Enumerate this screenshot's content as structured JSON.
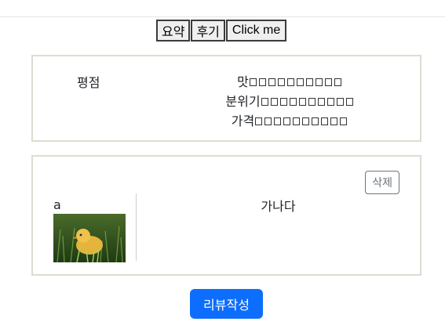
{
  "tabs": [
    {
      "label": "요약"
    },
    {
      "label": "후기"
    },
    {
      "label": "Click me"
    }
  ],
  "rating": {
    "label": "평점",
    "lines": [
      {
        "label": "맛",
        "boxes": 10
      },
      {
        "label": "분위기",
        "boxes": 10
      },
      {
        "label": "가격",
        "boxes": 10
      }
    ]
  },
  "review": {
    "author": "a",
    "delete_label": "삭제",
    "text": "가나다",
    "image_icon": "duckling-photo"
  },
  "write_button": {
    "label": "리뷰작성",
    "color": "#0d6efd"
  }
}
